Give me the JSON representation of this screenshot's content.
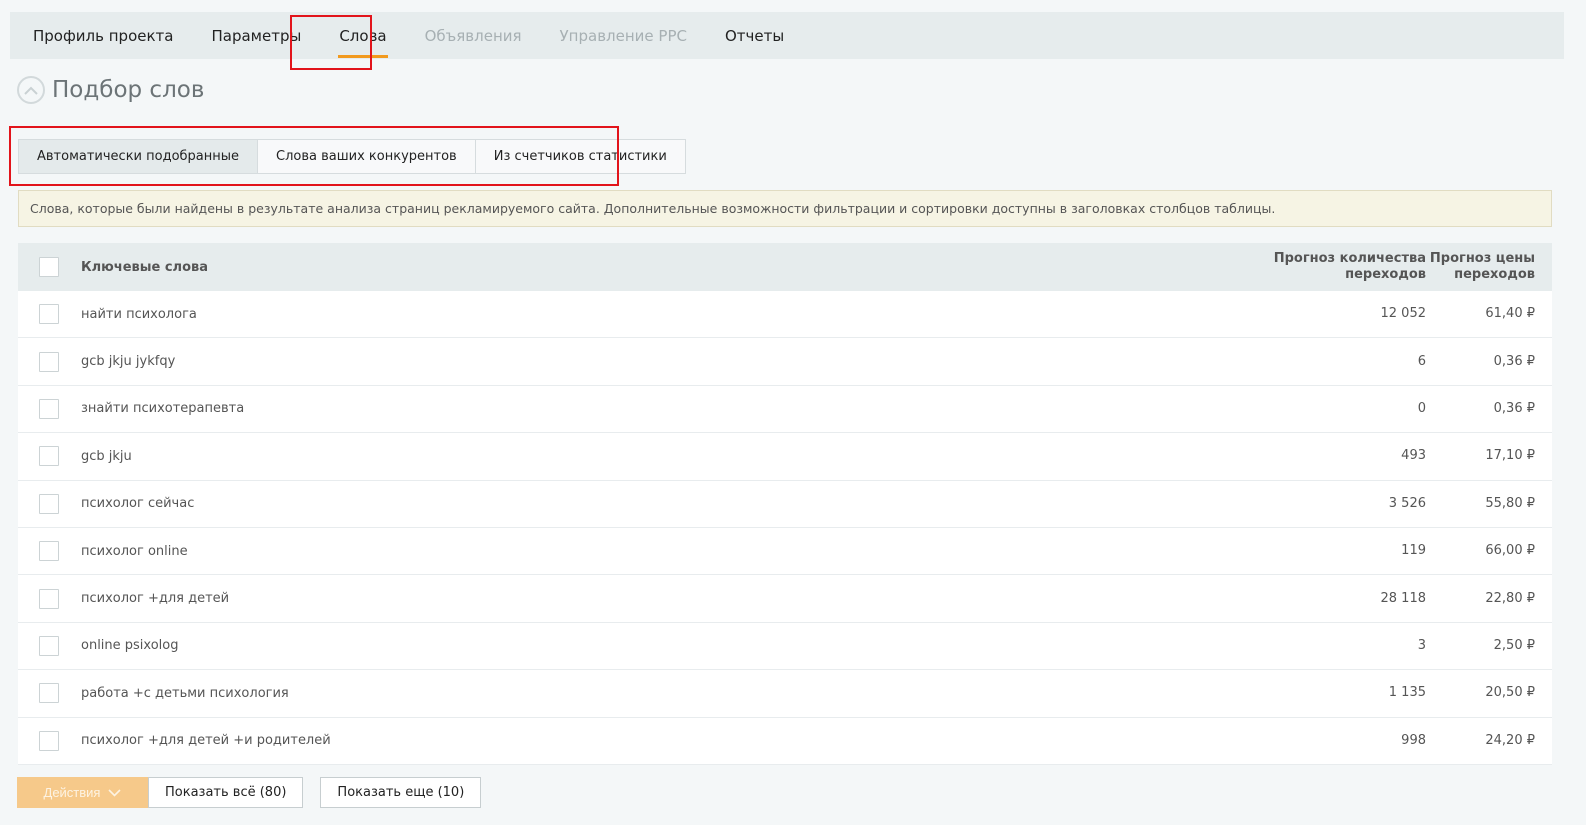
{
  "nav": {
    "tabs": [
      {
        "label": "Профиль проекта",
        "state": "normal"
      },
      {
        "label": "Параметры",
        "state": "normal"
      },
      {
        "label": "Слова",
        "state": "active"
      },
      {
        "label": "Объявления",
        "state": "disabled"
      },
      {
        "label": "Управление PPC",
        "state": "disabled"
      },
      {
        "label": "Отчеты",
        "state": "normal"
      }
    ]
  },
  "page": {
    "title": "Подбор слов",
    "collapse_icon": "chevron-up-circle-icon"
  },
  "subtabs": [
    {
      "label": "Автоматически подобранные",
      "active": true
    },
    {
      "label": "Слова ваших конкурентов",
      "active": false
    },
    {
      "label": "Из счетчиков статистики",
      "active": false
    }
  ],
  "info_text": "Слова, которые были найдены в результате анализа страниц рекламируемого сайта. Дополнительные возможности фильтрации и сортировки доступны в заголовках столбцов таблицы.",
  "table": {
    "headers": {
      "keyword": "Ключевые слова",
      "forecast_clicks_l1": "Прогноз количества",
      "forecast_clicks_l2": "переходов",
      "forecast_price_l1": "Прогноз цены",
      "forecast_price_l2": "переходов"
    },
    "rows": [
      {
        "keyword": "найти психолога",
        "clicks": "12 052",
        "price": "61,40 ₽"
      },
      {
        "keyword": "gcb jkju jykfqy",
        "clicks": "6",
        "price": "0,36 ₽"
      },
      {
        "keyword": "знайти психотерапевта",
        "clicks": "0",
        "price": "0,36 ₽"
      },
      {
        "keyword": "gcb jkju",
        "clicks": "493",
        "price": "17,10 ₽"
      },
      {
        "keyword": "психолог сейчас",
        "clicks": "3 526",
        "price": "55,80 ₽"
      },
      {
        "keyword": "психолог online",
        "clicks": "119",
        "price": "66,00 ₽"
      },
      {
        "keyword": "психолог +для детей",
        "clicks": "28 118",
        "price": "22,80 ₽"
      },
      {
        "keyword": "online psixolog",
        "clicks": "3",
        "price": "2,50 ₽"
      },
      {
        "keyword": "работа +с детьми психология",
        "clicks": "1 135",
        "price": "20,50 ₽"
      },
      {
        "keyword": "психолог +для детей +и родителей",
        "clicks": "998",
        "price": "24,20 ₽"
      }
    ]
  },
  "footer": {
    "actions_label": "Действия",
    "show_all_label": "Показать всё (80)",
    "show_more_label": "Показать еще (10)"
  },
  "colors": {
    "accent": "#f29a1e",
    "highlight_box": "#e2141b",
    "actions_button": "#f6c98a"
  }
}
